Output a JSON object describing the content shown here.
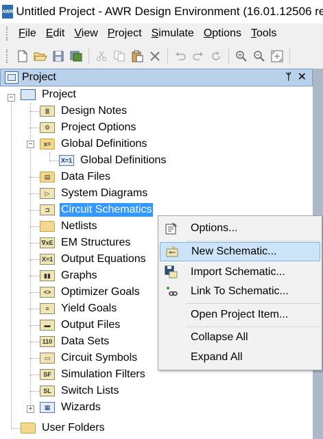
{
  "window": {
    "logo_text": "AWR",
    "title": "Untitled Project - AWR Design Environment (16.01.12506 re"
  },
  "menubar": {
    "items": [
      "File",
      "Edit",
      "View",
      "Project",
      "Simulate",
      "Options",
      "Tools"
    ],
    "mnemonics": [
      "F",
      "E",
      "V",
      "P",
      "S",
      "O",
      "T"
    ]
  },
  "toolbar": {
    "buttons": [
      "new-icon",
      "open-icon",
      "save-icon",
      "save-all-icon",
      "cut-icon",
      "copy-icon",
      "paste-icon",
      "delete-icon",
      "undo-icon",
      "redo-icon",
      "refresh-icon",
      "zoom-in-icon",
      "zoom-out-icon",
      "zoom-fit-icon"
    ]
  },
  "panel": {
    "title": "Project",
    "pin_glyph": "ᛘ",
    "close_glyph": "✕"
  },
  "tree": {
    "root": "Project",
    "items": [
      {
        "label": "Design Notes",
        "icon": "notes-icon"
      },
      {
        "label": "Project Options",
        "icon": "options-icon"
      },
      {
        "label": "Global Definitions",
        "icon": "global-definitions-folder-icon"
      },
      {
        "label": "Global Definitions",
        "icon": "xeq-icon",
        "badge": "X=1"
      },
      {
        "label": "Data Files",
        "icon": "data-files-icon"
      },
      {
        "label": "System Diagrams",
        "icon": "system-diagrams-icon"
      },
      {
        "label": "Circuit Schematics",
        "icon": "circuit-schematics-icon"
      },
      {
        "label": "Netlists",
        "icon": "folder-icon"
      },
      {
        "label": "EM Structures",
        "icon": "em-structures-icon",
        "badge": "∇xE"
      },
      {
        "label": "Output Equations",
        "icon": "output-equations-icon",
        "badge": "X=1"
      },
      {
        "label": "Graphs",
        "icon": "graphs-icon"
      },
      {
        "label": "Optimizer Goals",
        "icon": "optimizer-goals-icon"
      },
      {
        "label": "Yield Goals",
        "icon": "yield-goals-icon"
      },
      {
        "label": "Output Files",
        "icon": "output-files-icon"
      },
      {
        "label": "Data Sets",
        "icon": "data-sets-icon",
        "badge": "110"
      },
      {
        "label": "Circuit Symbols",
        "icon": "circuit-symbols-icon"
      },
      {
        "label": "Simulation Filters",
        "icon": "simulation-filters-icon",
        "badge": "SF"
      },
      {
        "label": "Switch Lists",
        "icon": "switch-lists-icon",
        "badge": "SL"
      },
      {
        "label": "Wizards",
        "icon": "wizards-icon"
      }
    ],
    "user_folders": "User Folders",
    "expander_minus": "−",
    "expander_plus": "+"
  },
  "context_menu": {
    "items": [
      {
        "label": "Options...",
        "icon": "options-icon"
      },
      {
        "label": "New Schematic...",
        "icon": "new-schematic-icon"
      },
      {
        "label": "Import Schematic...",
        "icon": "import-schematic-icon"
      },
      {
        "label": "Link To Schematic...",
        "icon": "link-icon"
      },
      {
        "label": "Open Project Item...",
        "icon": ""
      },
      {
        "label": "Collapse All",
        "icon": ""
      },
      {
        "label": "Expand All",
        "icon": ""
      }
    ]
  },
  "colors": {
    "selection": "#3399ff",
    "menu_hover": "#cce4f7",
    "panel_header": "#b9d1ea"
  }
}
